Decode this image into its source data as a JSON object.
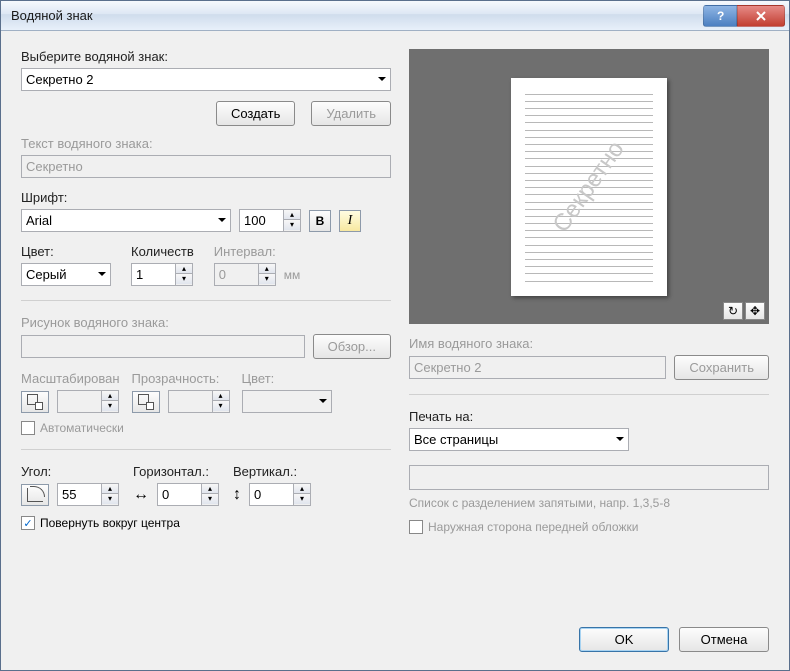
{
  "title": "Водяной знак",
  "labels": {
    "selectWatermark": "Выберите водяной знак:",
    "watermarkText": "Текст водяного знака:",
    "font": "Шрифт:",
    "color": "Цвет:",
    "count": "Количеств",
    "interval": "Интервал:",
    "mm": "мм",
    "picture": "Рисунок водяного знака:",
    "browse": "Обзор...",
    "scaling": "Масштабирован",
    "opacity": "Прозрачность:",
    "pcolor": "Цвет:",
    "auto": "Автоматически",
    "angle": "Угол:",
    "horizontal": "Горизонтал.:",
    "vertical": "Вертикал.:",
    "rotateCenter": "Повернуть вокруг центра",
    "name": "Имя водяного знака:",
    "save": "Сохранить",
    "printOn": "Печать на:",
    "listHint": "Список с разделением запятыми, напр. 1,3,5-8",
    "frontCover": "Наружная сторона передней обложки",
    "create": "Создать",
    "delete": "Удалить",
    "ok": "OK",
    "cancel": "Отмена"
  },
  "values": {
    "selectedWatermark": "Секретно 2",
    "textValue": "Секретно",
    "fontName": "Arial",
    "fontSize": "100",
    "colorName": "Серый",
    "count": "1",
    "interval": "0",
    "angle": "55",
    "horiz": "0",
    "vert": "0",
    "rotateCenterChecked": true,
    "nameValue": "Секретно 2",
    "printOnValue": "Все страницы",
    "previewText": "Секретно"
  }
}
